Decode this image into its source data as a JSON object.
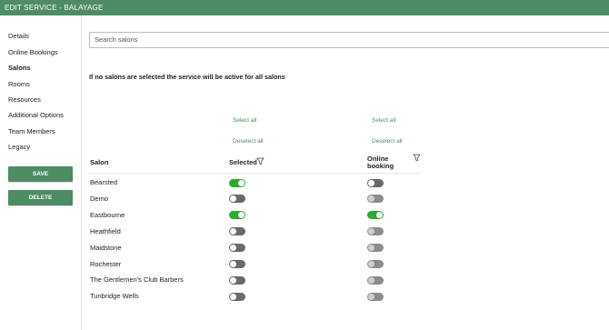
{
  "header": {
    "title": "EDIT SERVICE - BALAYAGE"
  },
  "sidebar": {
    "items": [
      {
        "label": "Details"
      },
      {
        "label": "Online Bookings"
      },
      {
        "label": "Salons"
      },
      {
        "label": "Rooms"
      },
      {
        "label": "Resources"
      },
      {
        "label": "Additional Options"
      },
      {
        "label": "Team Members"
      },
      {
        "label": "Legacy"
      }
    ],
    "active": "Salons",
    "save_label": "SAVE",
    "delete_label": "DELETE"
  },
  "search": {
    "placeholder": "Search salons"
  },
  "note": "If no salons are selected the service will be active for all salons",
  "selected_column": {
    "select_all": "Select all",
    "deselect_all": "Deselect all",
    "header": "Selected"
  },
  "online_column": {
    "select_all": "Select all",
    "deselect_all": "Deselect all",
    "header_line1": "Online",
    "header_line2": "booking"
  },
  "table": {
    "salon_header": "Salon"
  },
  "salons": [
    {
      "name": "Bearsted",
      "selected": true,
      "online": false
    },
    {
      "name": "Demo",
      "selected": false,
      "online": false
    },
    {
      "name": "Eastbourne",
      "selected": true,
      "online": true
    },
    {
      "name": "Heathfield",
      "selected": false,
      "online": false
    },
    {
      "name": "Maidstone",
      "selected": false,
      "online": false
    },
    {
      "name": "Rochester",
      "selected": false,
      "online": false
    },
    {
      "name": "The Gentlemen's Club Barbers",
      "selected": false,
      "online": false
    },
    {
      "name": "Tunbridge Wells",
      "selected": false,
      "online": false
    }
  ],
  "colors": {
    "brand": "#4e8c64",
    "toggle_on": "#2eaa2e",
    "toggle_off": "#6a6a6a",
    "toggle_disabled": "#8c8c8c"
  },
  "icons": {
    "filter": "filter-icon"
  }
}
